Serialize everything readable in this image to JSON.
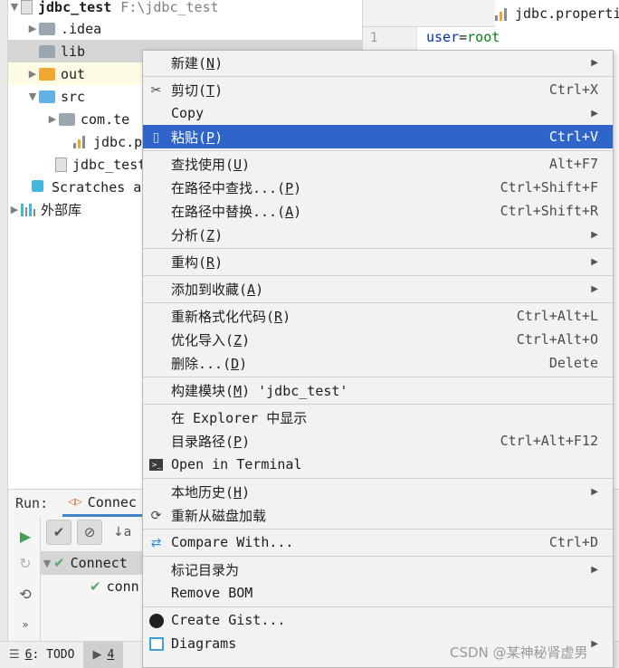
{
  "tree": {
    "project_name": "jdbc_test",
    "project_path": "F:\\jdbc_test",
    "items": [
      {
        "label": ".idea"
      },
      {
        "label": "lib"
      },
      {
        "label": "out"
      },
      {
        "label": "src"
      },
      {
        "label": "com.te"
      },
      {
        "label": "jdbc.p"
      },
      {
        "label": "jdbc_test"
      },
      {
        "label": "Scratches a"
      },
      {
        "label": "外部库"
      }
    ]
  },
  "editor": {
    "tab_label": "jdbc.properti",
    "line_number": "1",
    "code_key": "user",
    "code_eq": "=",
    "code_value": "root"
  },
  "run": {
    "label": "Run:",
    "tab_label": "Connec",
    "tree_root": "Connect",
    "tree_child": "conn"
  },
  "status_bar": {
    "todo_num": "6",
    "todo_label": ": TODO",
    "item4_num": "4"
  },
  "menu": {
    "items": [
      {
        "label": "新建(",
        "mn": "N",
        "tail": ")",
        "shortcut": "",
        "submenu": true
      },
      {
        "label": "剪切(",
        "mn": "T",
        "tail": ")",
        "shortcut": "Ctrl+X",
        "submenu": false,
        "icon": "scissors-icon"
      },
      {
        "label": "Copy",
        "mn": "",
        "tail": "",
        "shortcut": "",
        "submenu": true
      },
      {
        "label": "粘贴(",
        "mn": "P",
        "tail": ")",
        "shortcut": "Ctrl+V",
        "submenu": false,
        "icon": "clipboard-icon"
      },
      {
        "label": "查找使用(",
        "mn": "U",
        "tail": ")",
        "shortcut": "Alt+F7",
        "submenu": false
      },
      {
        "label": "在路径中查找...(",
        "mn": "P",
        "tail": ")",
        "shortcut": "Ctrl+Shift+F",
        "submenu": false
      },
      {
        "label": "在路径中替换...(",
        "mn": "A",
        "tail": ")",
        "shortcut": "Ctrl+Shift+R",
        "submenu": false
      },
      {
        "label": "分析(",
        "mn": "Z",
        "tail": ")",
        "shortcut": "",
        "submenu": true
      },
      {
        "label": "重构(",
        "mn": "R",
        "tail": ")",
        "shortcut": "",
        "submenu": true
      },
      {
        "label": "添加到收藏(",
        "mn": "A",
        "tail": ")",
        "shortcut": "",
        "submenu": true
      },
      {
        "label": "重新格式化代码(",
        "mn": "R",
        "tail": ")",
        "shortcut": "Ctrl+Alt+L",
        "submenu": false
      },
      {
        "label": "优化导入(",
        "mn": "Z",
        "tail": ")",
        "shortcut": "Ctrl+Alt+O",
        "submenu": false
      },
      {
        "label": "删除...(",
        "mn": "D",
        "tail": ")",
        "shortcut": "Delete",
        "submenu": false
      },
      {
        "label": "构建模块(",
        "mn": "M",
        "tail": ") 'jdbc_test'",
        "shortcut": "",
        "submenu": false
      },
      {
        "label": "在 Explorer 中显示",
        "mn": "",
        "tail": "",
        "shortcut": "",
        "submenu": false
      },
      {
        "label": "目录路径(",
        "mn": "P",
        "tail": ")",
        "shortcut": "Ctrl+Alt+F12",
        "submenu": false
      },
      {
        "label": "Open in Terminal",
        "mn": "",
        "tail": "",
        "shortcut": "",
        "submenu": false,
        "icon": "terminal-icon"
      },
      {
        "label": "本地历史(",
        "mn": "H",
        "tail": ")",
        "shortcut": "",
        "submenu": true
      },
      {
        "label": "重新从磁盘加载",
        "mn": "",
        "tail": "",
        "shortcut": "",
        "submenu": false,
        "icon": "reload-icon"
      },
      {
        "label": "Compare With...",
        "mn": "",
        "tail": "",
        "shortcut": "Ctrl+D",
        "submenu": false,
        "icon": "compare-icon"
      },
      {
        "label": "标记目录为",
        "mn": "",
        "tail": "",
        "shortcut": "",
        "submenu": true
      },
      {
        "label": "Remove BOM",
        "mn": "",
        "tail": "",
        "shortcut": "",
        "submenu": false
      },
      {
        "label": "Create Gist...",
        "mn": "",
        "tail": "",
        "shortcut": "",
        "submenu": false,
        "icon": "github-icon"
      },
      {
        "label": "Diagrams",
        "mn": "",
        "tail": "",
        "shortcut": "",
        "submenu": true,
        "icon": "diagram-icon"
      }
    ]
  },
  "watermark": "CSDN @某神秘肾虚男",
  "colors": {
    "menu_highlight": "#2f65ca",
    "selection_grey": "#d5d5d5",
    "check_green": "#59a869",
    "folder_orange": "#f0a732",
    "folder_blue": "#62b1e4"
  }
}
